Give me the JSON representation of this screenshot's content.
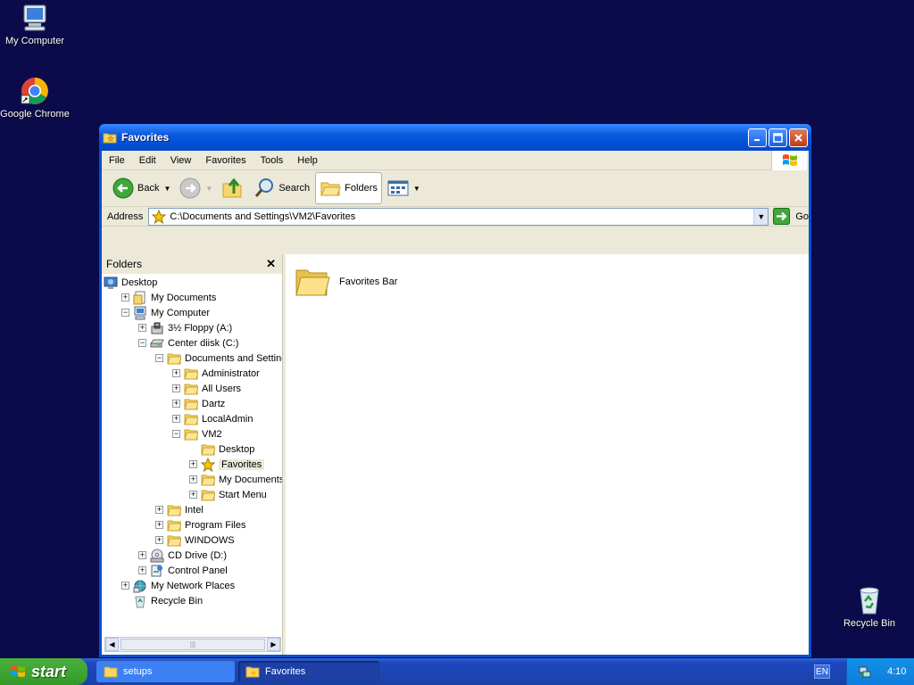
{
  "desktop": {
    "icons": [
      {
        "label": "My Computer"
      },
      {
        "label": "Google Chrome"
      },
      {
        "label": "Recycle Bin"
      }
    ]
  },
  "window": {
    "title": "Favorites",
    "menu": [
      "File",
      "Edit",
      "View",
      "Favorites",
      "Tools",
      "Help"
    ],
    "toolbar": {
      "back": "Back",
      "search": "Search",
      "folders": "Folders"
    },
    "address": {
      "label": "Address",
      "value": "C:\\Documents and Settings\\VM2\\Favorites",
      "go": "Go"
    },
    "folders_pane": {
      "title": "Folders",
      "tree": [
        {
          "label": "Desktop",
          "depth": 0,
          "expander": "none",
          "icon": "desktop-icon"
        },
        {
          "label": "My Documents",
          "depth": 1,
          "expander": "plus",
          "icon": "my-documents-icon"
        },
        {
          "label": "My Computer",
          "depth": 1,
          "expander": "minus",
          "icon": "my-computer-icon"
        },
        {
          "label": "3½ Floppy (A:)",
          "depth": 2,
          "expander": "plus",
          "icon": "floppy-icon"
        },
        {
          "label": "Center diisk (C:)",
          "depth": 2,
          "expander": "minus",
          "icon": "hard-disk-icon"
        },
        {
          "label": "Documents and Settings",
          "depth": 3,
          "expander": "minus",
          "icon": "folder-icon"
        },
        {
          "label": "Administrator",
          "depth": 4,
          "expander": "plus",
          "icon": "folder-icon"
        },
        {
          "label": "All Users",
          "depth": 4,
          "expander": "plus",
          "icon": "folder-icon"
        },
        {
          "label": "Dartz",
          "depth": 4,
          "expander": "plus",
          "icon": "folder-icon"
        },
        {
          "label": "LocalAdmin",
          "depth": 4,
          "expander": "plus",
          "icon": "folder-icon"
        },
        {
          "label": "VM2",
          "depth": 4,
          "expander": "minus",
          "icon": "folder-icon"
        },
        {
          "label": "Desktop",
          "depth": 5,
          "expander": "none",
          "icon": "folder-icon"
        },
        {
          "label": "Favorites",
          "depth": 5,
          "expander": "plus",
          "icon": "star-icon",
          "selected": true
        },
        {
          "label": "My Documents",
          "depth": 5,
          "expander": "plus",
          "icon": "folder-icon"
        },
        {
          "label": "Start Menu",
          "depth": 5,
          "expander": "plus",
          "icon": "folder-icon"
        },
        {
          "label": "Intel",
          "depth": 3,
          "expander": "plus",
          "icon": "folder-icon"
        },
        {
          "label": "Program Files",
          "depth": 3,
          "expander": "plus",
          "icon": "folder-icon"
        },
        {
          "label": "WINDOWS",
          "depth": 3,
          "expander": "plus",
          "icon": "folder-icon"
        },
        {
          "label": "CD Drive (D:)",
          "depth": 2,
          "expander": "plus",
          "icon": "cd-drive-icon"
        },
        {
          "label": "Control Panel",
          "depth": 2,
          "expander": "plus",
          "icon": "control-panel-icon"
        },
        {
          "label": "My Network Places",
          "depth": 1,
          "expander": "plus",
          "icon": "network-icon"
        },
        {
          "label": "Recycle Bin",
          "depth": 1,
          "expander": "none",
          "icon": "recycle-bin-icon"
        }
      ]
    },
    "content": {
      "items": [
        {
          "label": "Favorites Bar"
        }
      ]
    }
  },
  "taskbar": {
    "start": "start",
    "tasks": [
      {
        "label": "setups"
      },
      {
        "label": "Favorites"
      }
    ],
    "language": "EN",
    "clock": "4:10"
  }
}
